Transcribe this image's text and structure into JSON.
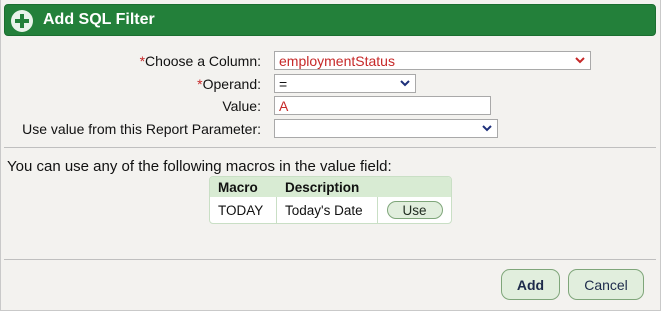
{
  "header": {
    "title": "Add SQL Filter"
  },
  "form": {
    "column": {
      "required_mark": "*",
      "label": "Choose a Column:",
      "value": "employmentStatus"
    },
    "operand": {
      "required_mark": "*",
      "label": "Operand:",
      "value": "="
    },
    "value": {
      "label": "Value:",
      "value": "A"
    },
    "report_param": {
      "label": "Use value from this Report Parameter:",
      "value": ""
    }
  },
  "macros": {
    "intro": "You can use any of the following macros in the value field:",
    "headers": [
      "Macro",
      "Description"
    ],
    "rows": [
      {
        "macro": "TODAY",
        "description": "Today's Date",
        "action": "Use"
      }
    ]
  },
  "footer": {
    "add_label": "Add",
    "cancel_label": "Cancel"
  },
  "colors": {
    "header": "#23803a",
    "required": "#c62828",
    "chevron_red": "#c62828",
    "chevron_blue": "#1d2f7a"
  }
}
